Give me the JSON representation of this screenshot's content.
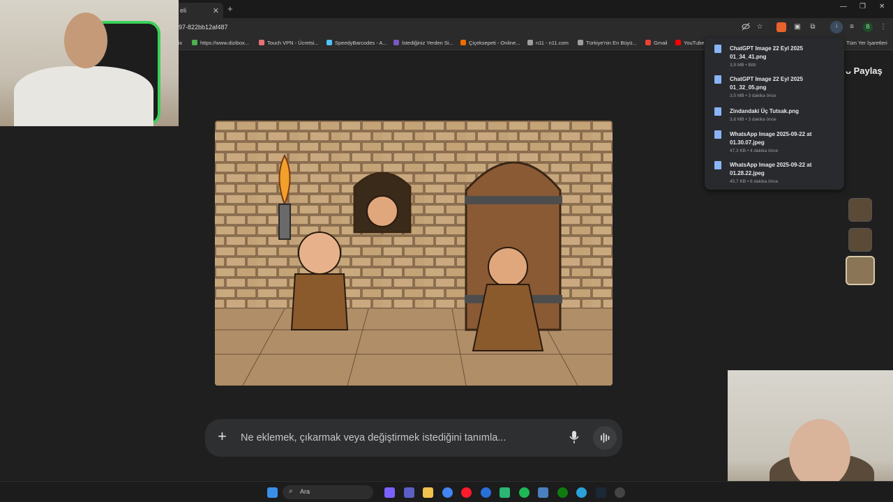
{
  "browser": {
    "tab_title": "eli",
    "tab_close": "✕",
    "new_tab": "+",
    "window_controls": [
      "—",
      "❐",
      "✕"
    ],
    "url": "97-822bb12af487",
    "bookmarks": [
      {
        "label": "lix",
        "color": "#e50914"
      },
      {
        "label": "https://www.dizibox...",
        "color": "#4caf50"
      },
      {
        "label": "Touch VPN - Ücretsi...",
        "color": "#e57373"
      },
      {
        "label": "SpeedyBarcodes - A...",
        "color": "#4fc3f7"
      },
      {
        "label": "İstediğiniz Yerden Si...",
        "color": "#7e57c2"
      },
      {
        "label": "Çiçeksepeti - Online...",
        "color": "#ef6c00"
      },
      {
        "label": "n11 - n11.com",
        "color": "#9e9e9e"
      },
      {
        "label": "Türkiye'nin En Büyü...",
        "color": "#9e9e9e"
      },
      {
        "label": "Gmail",
        "color": "#ea4335"
      },
      {
        "label": "YouTube",
        "color": "#ff0000"
      }
    ],
    "bookmarks_all": "Tüm Yer İşaretleri",
    "profile_initial": "B"
  },
  "page": {
    "share_label": "Paylaş",
    "prompt_plus": "+",
    "prompt_placeholder": "Ne eklemek, çıkarmak veya değiştirmek istediğini tanımla..."
  },
  "downloads": [
    {
      "name": "ChatGPT Image 22 Eyl 2025 01_34_41.png",
      "meta": "3,9 MB • Bitti"
    },
    {
      "name": "ChatGPT Image 22 Eyl 2025 01_32_05.png",
      "meta": "3,5 MB • 3 dakika önce"
    },
    {
      "name": "Zindandaki Üç Tutsak.png",
      "meta": "3,8 MB • 3 dakika önce"
    },
    {
      "name": "WhatsApp Image 2025-09-22 at 01.30.07.jpeg",
      "meta": "47,3 KB • 4 dakika önce"
    },
    {
      "name": "WhatsApp Image 2025-09-22 at 01.28.22.jpeg",
      "meta": "45,7 KB • 6 dakika önce"
    }
  ],
  "taskbar": {
    "search_label": "Ara"
  }
}
